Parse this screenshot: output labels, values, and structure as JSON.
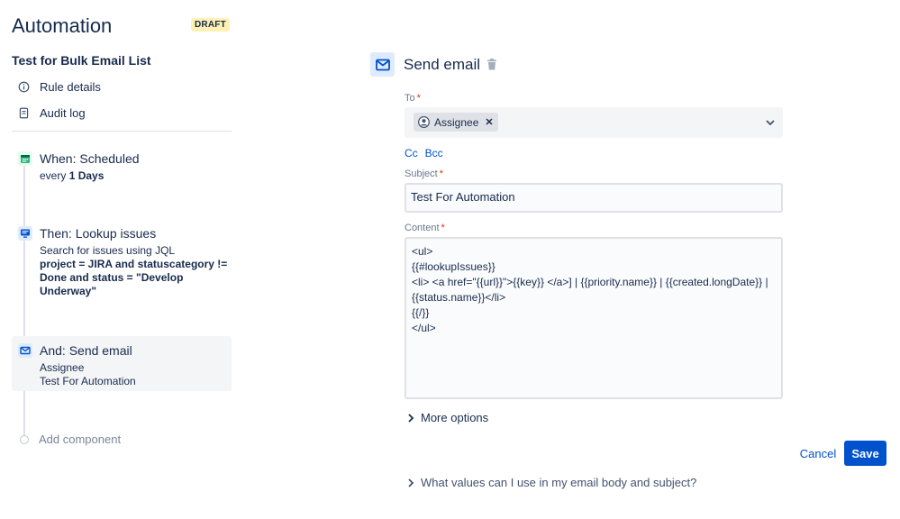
{
  "header": {
    "title": "Automation",
    "badge": "DRAFT"
  },
  "rule": {
    "name": "Test for Bulk Email List",
    "nav": [
      {
        "label": "Rule details",
        "icon": "info-icon"
      },
      {
        "label": "Audit log",
        "icon": "document-icon"
      }
    ]
  },
  "steps": [
    {
      "title": "When: Scheduled",
      "sub_prefix": "every ",
      "sub_bold": "1 Days",
      "icon": "calendar-icon",
      "color": "#36b37e"
    },
    {
      "title": "Then: Lookup issues",
      "sub": "Search for issues using JQL",
      "bold_lines": [
        "project = JIRA and statuscategory !=",
        "Done and status = \"Develop",
        "Underway\""
      ],
      "icon": "monitor-icon",
      "color": "#0052cc"
    },
    {
      "title": "And: Send email",
      "lines": [
        "Assignee",
        "Test For Automation"
      ],
      "icon": "mail-icon",
      "color": "#0052cc"
    }
  ],
  "add_component": "Add component",
  "action": {
    "title": "Send email",
    "to_label": "To",
    "to_chip": "Assignee",
    "cc": "Cc",
    "bcc": "Bcc",
    "subject_label": "Subject",
    "subject_value": "Test For Automation",
    "content_label": "Content",
    "content_lines": [
      "<ul>",
      "{{#lookupIssues}}",
      "<li> <a href=\"{{url}}\">{{key}} </a>] | {{priority.name}} |  {{created.longDate}} |",
      "{{status.name}}</li>",
      "{{/}}",
      "</ul>"
    ],
    "more_options": "More options",
    "cancel": "Cancel",
    "save": "Save",
    "help": "What values can I use in my email body and subject?"
  },
  "colors": {
    "primary": "#0052cc",
    "draft_bg": "#fff0b3",
    "required": "#de350b",
    "success": "#36b37e"
  }
}
